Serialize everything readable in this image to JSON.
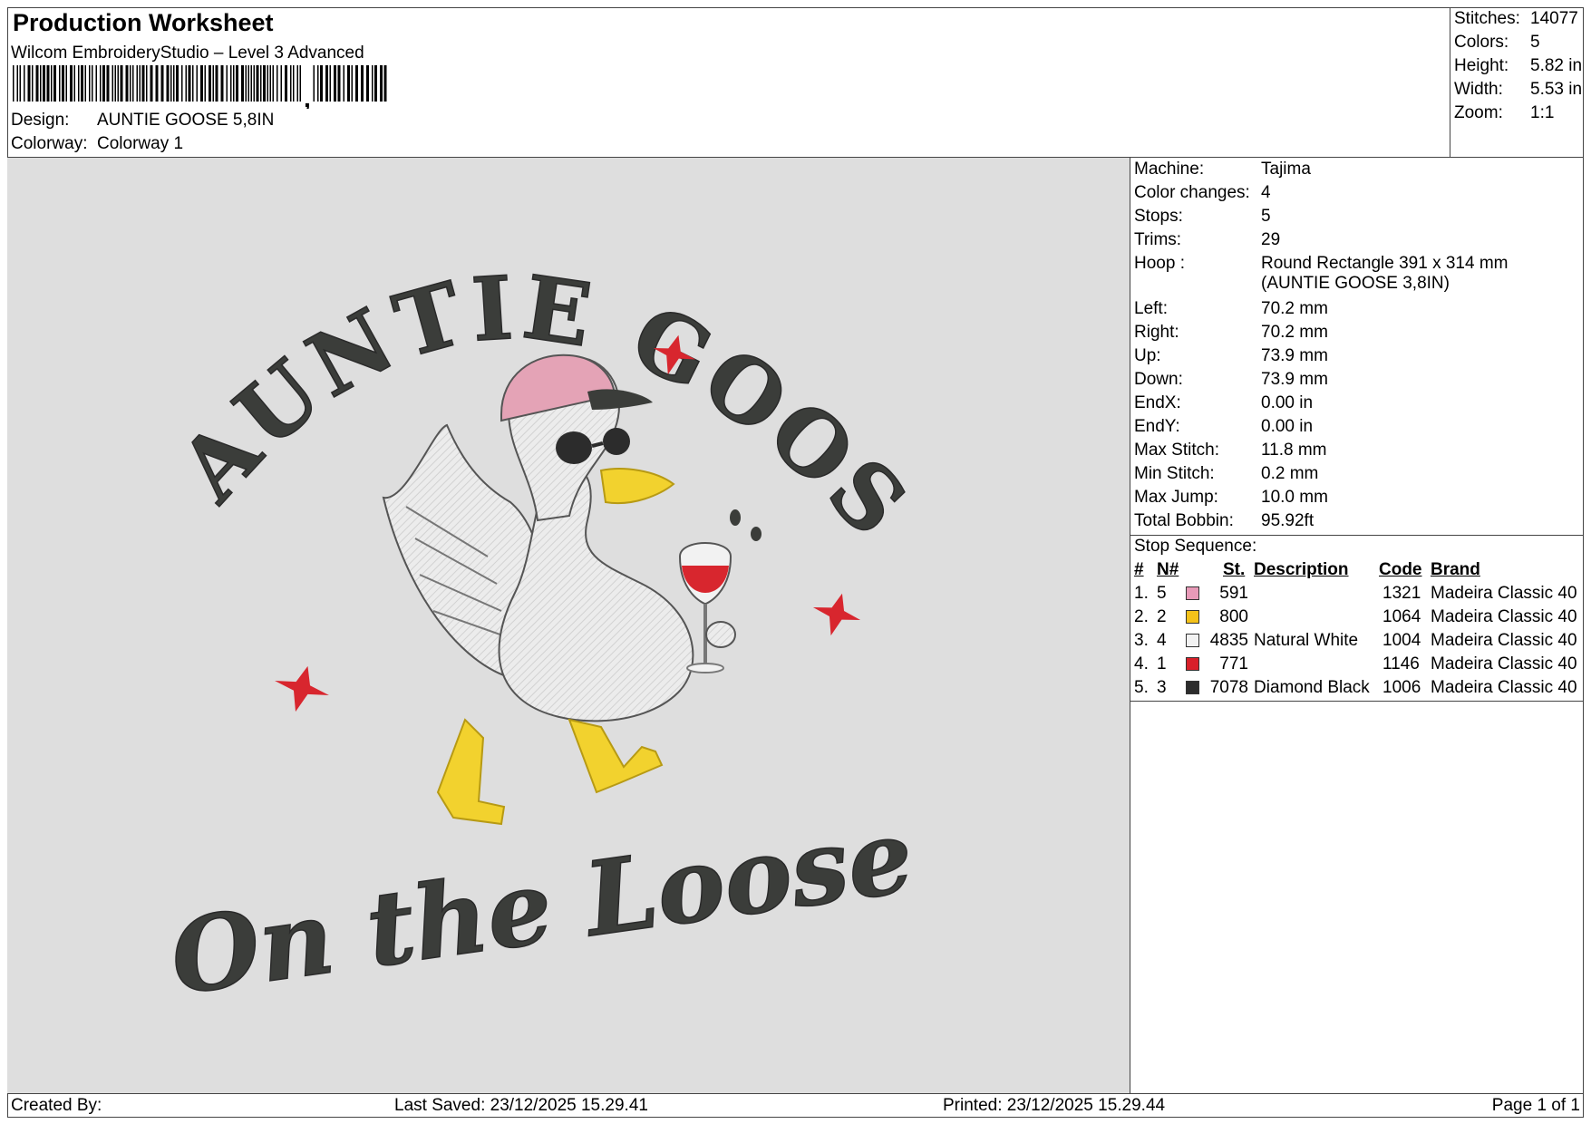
{
  "header": {
    "title": "Production Worksheet",
    "software": "Wilcom EmbroideryStudio – Level 3 Advanced",
    "design_label": "Design:",
    "design_value": "AUNTIE GOOSE 5,8IN",
    "colorway_label": "Colorway:",
    "colorway_value": "Colorway 1"
  },
  "summary": [
    {
      "label": "Stitches:",
      "value": "14077"
    },
    {
      "label": "Colors:",
      "value": "5"
    },
    {
      "label": "Height:",
      "value": "5.82 in"
    },
    {
      "label": "Width:",
      "value": "5.53 in"
    },
    {
      "label": "Zoom:",
      "value": "1:1"
    }
  ],
  "artwork": {
    "top_text": "AUNTIE GOOSE",
    "bottom_text": "On the Loose",
    "colors": {
      "pink": "#e4a3b6",
      "yellow": "#f2d22e",
      "white": "#ececec",
      "red": "#d8262e",
      "black": "#3b3d3a"
    }
  },
  "machine_info": [
    {
      "label": "Machine:",
      "value": "Tajima"
    },
    {
      "label": "Color changes:",
      "value": "4"
    },
    {
      "label": "Stops:",
      "value": "5"
    },
    {
      "label": "Trims:",
      "value": "29"
    },
    {
      "label": "Hoop :",
      "value": "Round Rectangle 391 x 314 mm",
      "value2": "(AUNTIE GOOSE 3,8IN)"
    },
    {
      "label": "Left:",
      "value": "70.2 mm"
    },
    {
      "label": "Right:",
      "value": "70.2 mm"
    },
    {
      "label": "Up:",
      "value": "73.9 mm"
    },
    {
      "label": "Down:",
      "value": "73.9 mm"
    },
    {
      "label": "EndX:",
      "value": "0.00 in"
    },
    {
      "label": "EndY:",
      "value": "0.00 in"
    },
    {
      "label": "Max Stitch:",
      "value": "11.8 mm"
    },
    {
      "label": "Min Stitch:",
      "value": "0.2 mm"
    },
    {
      "label": "Max Jump:",
      "value": "10.0 mm"
    },
    {
      "label": "Total Bobbin:",
      "value": "95.92ft"
    }
  ],
  "stop_sequence": {
    "title": "Stop Sequence:",
    "headers": {
      "num": "#",
      "n": "N#",
      "st": "St.",
      "description": "Description",
      "code": "Code",
      "brand": "Brand"
    },
    "rows": [
      {
        "num": "1.",
        "n": "5",
        "color": "#e89ab8",
        "st": "591",
        "description": "",
        "code": "1321",
        "brand": "Madeira Classic 40"
      },
      {
        "num": "2.",
        "n": "2",
        "color": "#f4c21a",
        "st": "800",
        "description": "",
        "code": "1064",
        "brand": "Madeira Classic 40"
      },
      {
        "num": "3.",
        "n": "4",
        "color": "#f2f2f2",
        "st": "4835",
        "description": "Natural White",
        "code": "1004",
        "brand": "Madeira Classic 40"
      },
      {
        "num": "4.",
        "n": "1",
        "color": "#d8202a",
        "st": "771",
        "description": "",
        "code": "1146",
        "brand": "Madeira Classic 40"
      },
      {
        "num": "5.",
        "n": "3",
        "color": "#2c2c2c",
        "st": "7078",
        "description": "Diamond Black",
        "code": "1006",
        "brand": "Madeira Classic 40"
      }
    ]
  },
  "footer": {
    "created_by": "Created By:",
    "last_saved": "Last Saved: 23/12/2025 15.29.41",
    "printed": "Printed: 23/12/2025 15.29.44",
    "page": "Page 1 of 1"
  }
}
